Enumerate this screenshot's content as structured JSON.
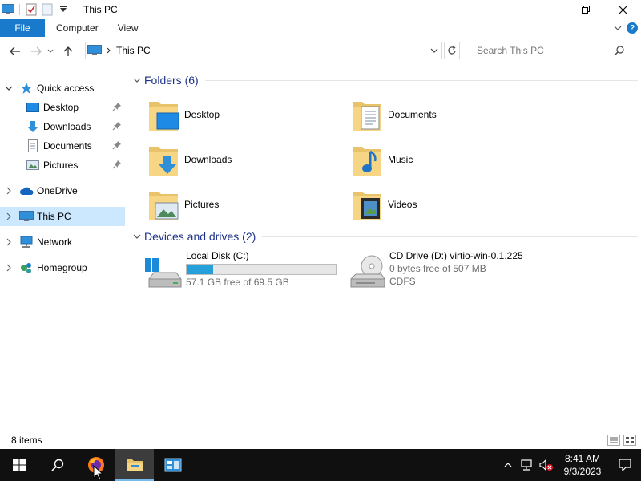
{
  "window": {
    "title": "This PC",
    "controls": {
      "minimize": "minimize",
      "maximize": "restore",
      "close": "close"
    }
  },
  "ribbon": {
    "tabs": [
      "File",
      "Computer",
      "View"
    ]
  },
  "address": {
    "path": "This PC",
    "search_placeholder": "Search This PC"
  },
  "nav": {
    "items": [
      {
        "label": "Quick access",
        "icon": "star-icon",
        "expanded": true
      },
      {
        "label": "Desktop",
        "icon": "desktop-icon",
        "pinned": true
      },
      {
        "label": "Downloads",
        "icon": "download-arrow-icon",
        "pinned": true
      },
      {
        "label": "Documents",
        "icon": "document-icon",
        "pinned": true
      },
      {
        "label": "Pictures",
        "icon": "pictures-icon",
        "pinned": true
      },
      {
        "label": "OneDrive",
        "icon": "cloud-icon"
      },
      {
        "label": "This PC",
        "icon": "computer-icon",
        "selected": true
      },
      {
        "label": "Network",
        "icon": "network-icon"
      },
      {
        "label": "Homegroup",
        "icon": "homegroup-icon"
      }
    ]
  },
  "folders": {
    "header": "Folders (6)",
    "items": [
      {
        "label": "Desktop"
      },
      {
        "label": "Documents"
      },
      {
        "label": "Downloads"
      },
      {
        "label": "Music"
      },
      {
        "label": "Pictures"
      },
      {
        "label": "Videos"
      }
    ]
  },
  "drives": {
    "header": "Devices and drives (2)",
    "items": [
      {
        "name": "Local Disk (C:)",
        "free": "57.1 GB free of 69.5 GB",
        "used_fraction": 0.178
      },
      {
        "name": "CD Drive (D:) virtio-win-0.1.225",
        "free": "0 bytes free of 507 MB",
        "fs": "CDFS"
      }
    ]
  },
  "status": {
    "items": "8 items"
  },
  "taskbar": {
    "time": "8:41 AM",
    "date": "9/3/2023"
  },
  "colors": {
    "accent": "#1979ca",
    "selection": "#cce8ff",
    "group_header": "#1e3287",
    "progress": "#26a0da"
  }
}
